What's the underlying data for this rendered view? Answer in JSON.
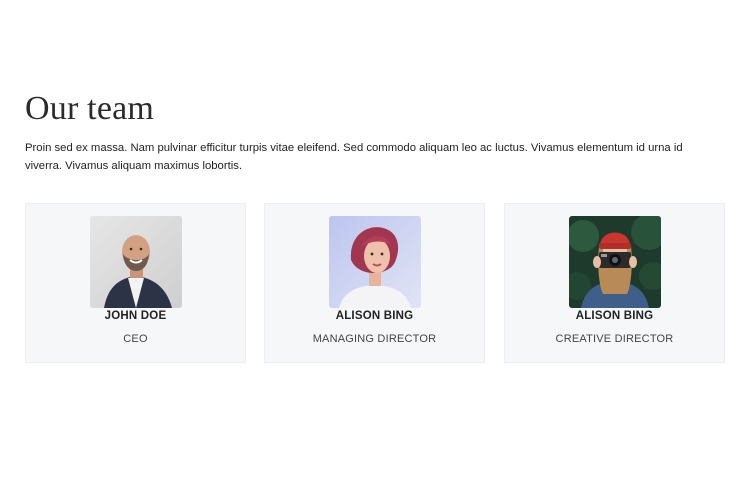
{
  "section": {
    "title": "Our team",
    "intro": "Proin sed ex massa. Nam pulvinar efficitur turpis vitae eleifend. Sed commodo aliquam leo ac luctus. Vivamus elementum id urna id viverra. Vivamus aliquam maximus lobortis."
  },
  "team": [
    {
      "name": "JOHN DOE",
      "role": "CEO",
      "photo_icon": "portrait-man-suit"
    },
    {
      "name": "ALISON BING",
      "role": "MANAGING DIRECTOR",
      "photo_icon": "portrait-woman-red-hair"
    },
    {
      "name": "ALISON BING",
      "role": "CREATIVE DIRECTOR",
      "photo_icon": "portrait-woman-camera"
    }
  ],
  "colors": {
    "card_background": "#f6f7f9",
    "text": "#222222"
  }
}
